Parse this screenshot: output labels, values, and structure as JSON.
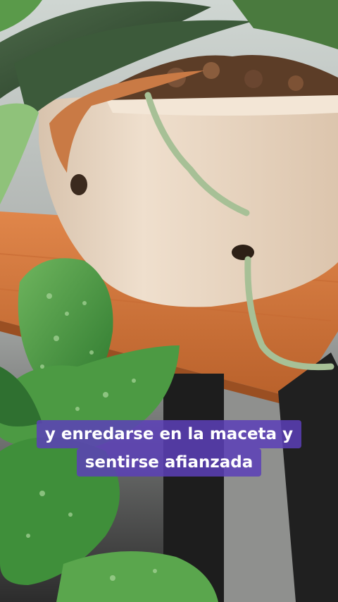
{
  "caption": {
    "line1": "y enredarse en la maceta y",
    "line2": "sentirse afianzada"
  },
  "colors": {
    "caption_bg": "#5c40b8",
    "caption_text": "#ffffff",
    "pot": "#e6d2bd",
    "table_wood": "#d4783a",
    "table_legs": "#1d1d1d",
    "leaf_green": "#3f8f3a",
    "root_green": "#a7c096"
  }
}
